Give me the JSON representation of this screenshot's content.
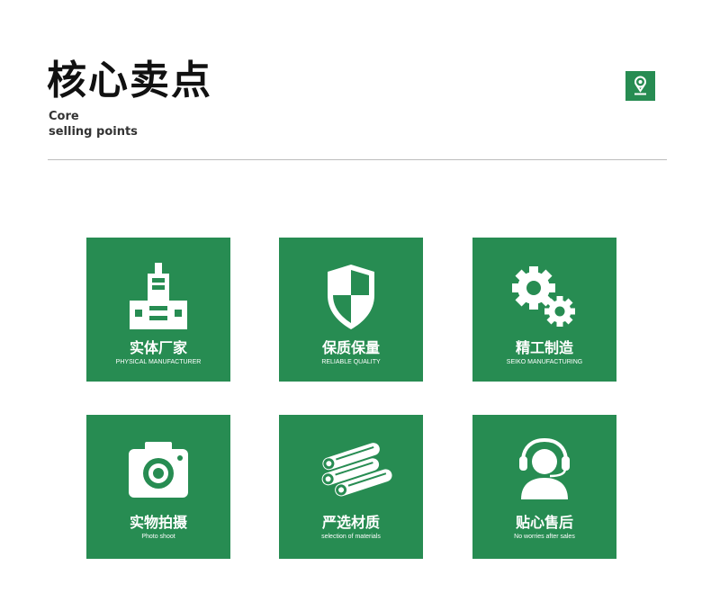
{
  "header": {
    "title": "核心卖点",
    "subtitle_line1": "Core",
    "subtitle_line2": "selling points",
    "badge_icon": "map-pin-icon"
  },
  "colors": {
    "brand_green": "#278c52",
    "text_dark": "#111111",
    "divider": "#bdbdbd"
  },
  "cards": [
    {
      "cn": "实体厂家",
      "en": "PHYSICAL MANUFACTURER",
      "icon": "factory-icon"
    },
    {
      "cn": "保质保量",
      "en": "RELIABLE QUALITY",
      "icon": "shield-icon"
    },
    {
      "cn": "精工制造",
      "en": "SEIKO MANUFACTURING",
      "icon": "gears-icon"
    },
    {
      "cn": "实物拍摄",
      "en": "Photo shoot",
      "icon": "camera-icon"
    },
    {
      "cn": "严选材质",
      "en": "selection of materials",
      "icon": "pipes-icon"
    },
    {
      "cn": "贴心售后",
      "en": "No worries after sales",
      "icon": "headset-icon"
    }
  ]
}
